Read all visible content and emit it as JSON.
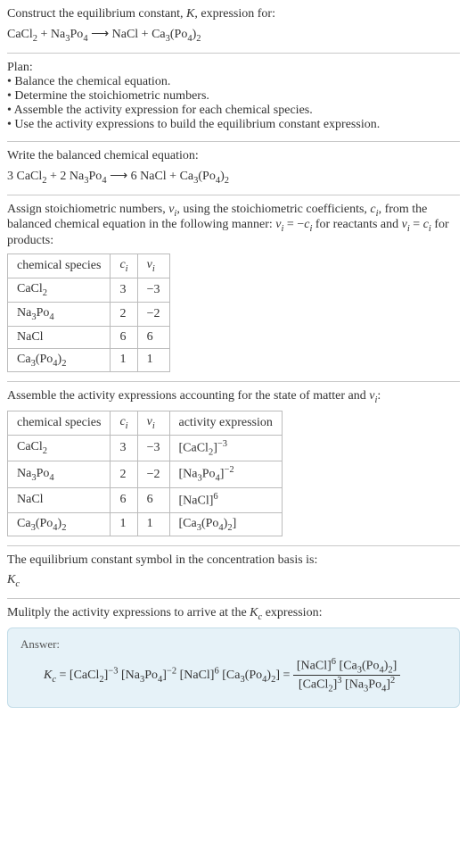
{
  "intro": {
    "line1": "Construct the equilibrium constant, <i>K</i>, expression for:",
    "equation": "CaCl<sub>2</sub> + Na<sub>3</sub>Po<sub>4</sub>  ⟶  NaCl + Ca<sub>3</sub>(Po<sub>4</sub>)<sub>2</sub>"
  },
  "plan": {
    "heading": "Plan:",
    "items": [
      "• Balance the chemical equation.",
      "• Determine the stoichiometric numbers.",
      "• Assemble the activity expression for each chemical species.",
      "• Use the activity expressions to build the equilibrium constant expression."
    ]
  },
  "balanced": {
    "heading": "Write the balanced chemical equation:",
    "equation": "3 CaCl<sub>2</sub> + 2 Na<sub>3</sub>Po<sub>4</sub>  ⟶  6 NaCl + Ca<sub>3</sub>(Po<sub>4</sub>)<sub>2</sub>"
  },
  "stoich": {
    "heading": "Assign stoichiometric numbers, <i>ν<sub>i</sub></i>, using the stoichiometric coefficients, <i>c<sub>i</sub></i>, from the balanced chemical equation in the following manner: <i>ν<sub>i</sub></i> = −<i>c<sub>i</sub></i> for reactants and <i>ν<sub>i</sub></i> = <i>c<sub>i</sub></i> for products:",
    "headers": [
      "chemical species",
      "<i>c<sub>i</sub></i>",
      "<i>ν<sub>i</sub></i>"
    ],
    "rows": [
      [
        "CaCl<sub>2</sub>",
        "3",
        "−3"
      ],
      [
        "Na<sub>3</sub>Po<sub>4</sub>",
        "2",
        "−2"
      ],
      [
        "NaCl",
        "6",
        "6"
      ],
      [
        "Ca<sub>3</sub>(Po<sub>4</sub>)<sub>2</sub>",
        "1",
        "1"
      ]
    ]
  },
  "activity": {
    "heading": "Assemble the activity expressions accounting for the state of matter and <i>ν<sub>i</sub></i>:",
    "headers": [
      "chemical species",
      "<i>c<sub>i</sub></i>",
      "<i>ν<sub>i</sub></i>",
      "activity expression"
    ],
    "rows": [
      [
        "CaCl<sub>2</sub>",
        "3",
        "−3",
        "[CaCl<sub>2</sub>]<sup>−3</sup>"
      ],
      [
        "Na<sub>3</sub>Po<sub>4</sub>",
        "2",
        "−2",
        "[Na<sub>3</sub>Po<sub>4</sub>]<sup>−2</sup>"
      ],
      [
        "NaCl",
        "6",
        "6",
        "[NaCl]<sup>6</sup>"
      ],
      [
        "Ca<sub>3</sub>(Po<sub>4</sub>)<sub>2</sub>",
        "1",
        "1",
        "[Ca<sub>3</sub>(Po<sub>4</sub>)<sub>2</sub>]"
      ]
    ]
  },
  "symbol": {
    "heading": "The equilibrium constant symbol in the concentration basis is:",
    "symbol": "<i>K<sub>c</sub></i>"
  },
  "multiply": {
    "heading": "Mulitply the activity expressions to arrive at the <i>K<sub>c</sub></i> expression:"
  },
  "answer": {
    "title": "Answer:",
    "lhs": "<i>K<sub>c</sub></i> = [CaCl<sub>2</sub>]<sup>−3</sup> [Na<sub>3</sub>Po<sub>4</sub>]<sup>−2</sup> [NaCl]<sup>6</sup> [Ca<sub>3</sub>(Po<sub>4</sub>)<sub>2</sub>] = ",
    "num": "[NaCl]<sup>6</sup> [Ca<sub>3</sub>(Po<sub>4</sub>)<sub>2</sub>]",
    "den": "[CaCl<sub>2</sub>]<sup>3</sup> [Na<sub>3</sub>Po<sub>4</sub>]<sup>2</sup>"
  }
}
